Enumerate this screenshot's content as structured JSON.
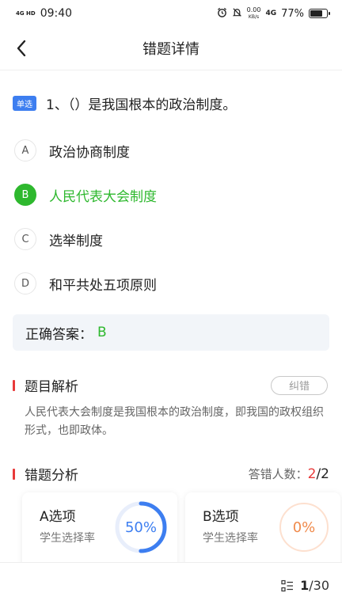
{
  "status_bar": {
    "network": "4G HD",
    "time": "09:40",
    "speed_value": "0.00",
    "speed_unit": "KB/s",
    "signal": "4G",
    "battery": "77%",
    "battery_level": 0.77
  },
  "header": {
    "title": "错题详情"
  },
  "question": {
    "type_badge": "单选",
    "text": "1、（）是我国根本的政治制度。",
    "options": [
      {
        "letter": "A",
        "text": "政治协商制度"
      },
      {
        "letter": "B",
        "text": "人民代表大会制度"
      },
      {
        "letter": "C",
        "text": "选举制度"
      },
      {
        "letter": "D",
        "text": "和平共处五项原则"
      }
    ],
    "answer_label": "正确答案：",
    "answer_value": "B"
  },
  "analysis": {
    "title": "题目解析",
    "correct_button": "纠错",
    "text": "人民代表大会制度是我国根本的政治制度，即我国的政权组织形式，也即政体。"
  },
  "error_analysis": {
    "title": "错题分析",
    "count_label": "答错人数：",
    "wrong_count": "2",
    "total_suffix": "/2",
    "cards": [
      {
        "title": "A选项",
        "subtitle": "学生选择率",
        "rate_text": "50%",
        "rate": 0.5
      },
      {
        "title": "B选项",
        "subtitle": "学生选择率",
        "rate_text": "0%",
        "rate": 0
      }
    ]
  },
  "colors": {
    "accent_blue": "#3d7ef0",
    "correct_green": "#2eb82e",
    "alert_red": "#e83a3a",
    "ring_orange_track": "#fde0cf",
    "ring_orange_text": "#f08a4b",
    "ring_blue_track": "#e8eefb"
  },
  "footer": {
    "current": "1",
    "total": "/30",
    "icon": "list-icon"
  }
}
